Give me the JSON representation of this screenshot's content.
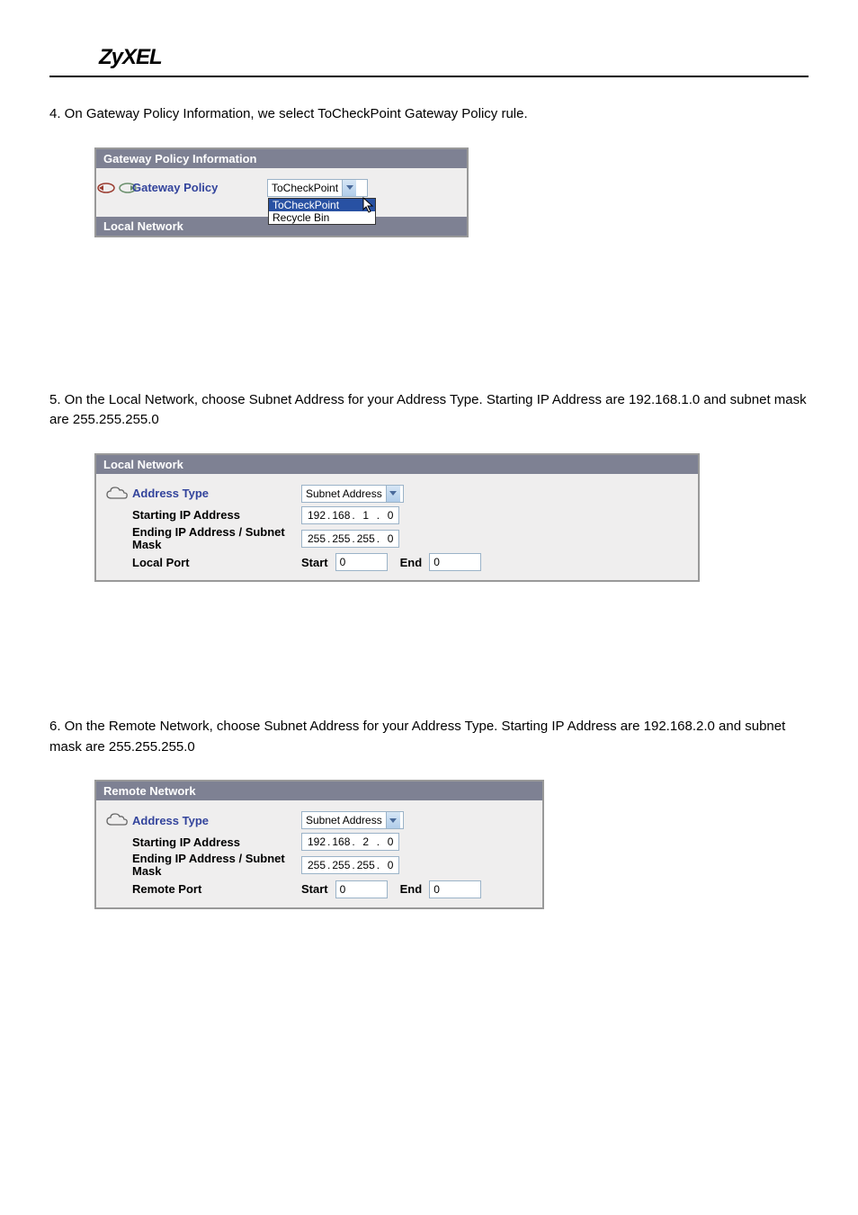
{
  "logo": "ZyXEL",
  "steps": {
    "s4": "4. On Gateway Policy Information, we select ToCheckPoint Gateway Policy rule.",
    "s5": "5. On the Local Network, choose Subnet Address for your Address Type. Starting IP Address are 192.168.1.0 and subnet mask are 255.255.255.0",
    "s6": "6. On the Remote Network, choose Subnet Address for your Address Type. Starting IP Address are 192.168.2.0 and subnet mask are 255.255.255.0"
  },
  "panel1": {
    "title": "Gateway Policy Information",
    "gateway_label": "Gateway Policy",
    "gateway_select": "ToCheckPoint",
    "dropdown": {
      "opt1": "ToCheckPoint",
      "opt2": "Recycle Bin"
    },
    "sub": "Local Network"
  },
  "panel2": {
    "title": "Local Network",
    "address_type": "Address Type",
    "address_type_val": "Subnet Address",
    "starting_ip": "Starting IP Address",
    "ip1": {
      "a": "192",
      "b": "168",
      "c": "1",
      "d": "0"
    },
    "ending": "Ending IP Address / Subnet Mask",
    "mask1": {
      "a": "255",
      "b": "255",
      "c": "255",
      "d": "0"
    },
    "local_port": "Local Port",
    "start": "Start",
    "start_val": "0",
    "end": "End",
    "end_val": "0"
  },
  "panel3": {
    "title": "Remote Network",
    "address_type": "Address Type",
    "address_type_val": "Subnet Address",
    "starting_ip": "Starting IP Address",
    "ip1": {
      "a": "192",
      "b": "168",
      "c": "2",
      "d": "0"
    },
    "ending": "Ending IP Address / Subnet Mask",
    "mask1": {
      "a": "255",
      "b": "255",
      "c": "255",
      "d": "0"
    },
    "remote_port": "Remote Port",
    "start": "Start",
    "start_val": "0",
    "end": "End",
    "end_val": "0"
  }
}
